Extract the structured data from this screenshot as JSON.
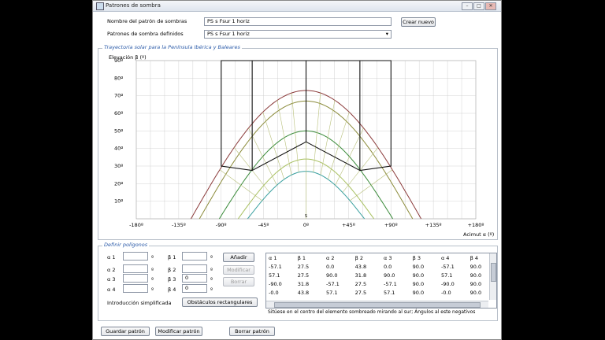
{
  "window": {
    "title": "Patrones de sombra"
  },
  "form": {
    "pattern_name_label": "Nombre del patrón de sombras",
    "pattern_name_value": "PS s Fsur 1 horiz",
    "create_button": "Crear nuevo",
    "defined_label": "Patrones de sombra definidos",
    "defined_value": "PS s Fsur 1 horiz"
  },
  "chart_group_title": "Trayectoria solar para la Península Ibérica y Baleares",
  "chart_data": {
    "type": "line",
    "ylabel": "Elevación β (º)",
    "xlabel": "Acimut α (º)",
    "xlim": [
      -180,
      180
    ],
    "ylim": [
      0,
      90
    ],
    "x_ticks": [
      "-180º",
      "-135º",
      "-90º",
      "-45º",
      "0º",
      "+45º",
      "+90º",
      "+135º",
      "+180º"
    ],
    "y_ticks": [
      "10º",
      "20º",
      "30º",
      "40º",
      "50º",
      "60º",
      "70º",
      "80º",
      "90º"
    ],
    "south_marker": "S",
    "sun_paths": [
      {
        "color": "#8b3a3a",
        "max_elevation": 73,
        "half_width": 122
      },
      {
        "color": "#8b8b3a",
        "max_elevation": 67,
        "half_width": 113
      },
      {
        "color": "#3a8b3a",
        "max_elevation": 50,
        "half_width": 92
      },
      {
        "color": "#a8c060",
        "max_elevation": 34,
        "half_width": 72
      },
      {
        "color": "#3aa0a0",
        "max_elevation": 27,
        "half_width": 62
      }
    ],
    "shadow_polygon": [
      {
        "x": -90,
        "y": 30
      },
      {
        "x": -90,
        "y": 90
      },
      {
        "x": 90,
        "y": 90
      },
      {
        "x": 90,
        "y": 30
      },
      {
        "x": 57.1,
        "y": 27.5
      },
      {
        "x": 0,
        "y": 43.8
      },
      {
        "x": -57.1,
        "y": 27.5
      }
    ],
    "polygon_dividers": [
      -57.1,
      0,
      57.1
    ]
  },
  "polygons": {
    "group_title": "Definir polígonos",
    "inputs": [
      {
        "alpha_label": "α 1",
        "alpha_value": "",
        "beta_label": "β 1",
        "beta_value": ""
      },
      {
        "alpha_label": "α 2",
        "alpha_value": "",
        "beta_label": "β 2",
        "beta_value": ""
      },
      {
        "alpha_label": "α 3",
        "alpha_value": "",
        "beta_label": "β 3",
        "beta_value": "0"
      },
      {
        "alpha_label": "α 4",
        "alpha_value": "",
        "beta_label": "β 4",
        "beta_value": "0"
      }
    ],
    "degree_symbol": "º",
    "add_button": "Añadir",
    "modify_button": "Modificar",
    "delete_button": "Borrar",
    "simplified_label": "Introducción simplificada",
    "rect_obstacles_button": "Obstáculos rectangulares",
    "table": {
      "headers": [
        "α 1",
        "β 1",
        "α 2",
        "β 2",
        "α 3",
        "β 3",
        "α 4",
        "β 4"
      ],
      "rows": [
        [
          "-57.1",
          "27.5",
          "0.0",
          "43.8",
          "0.0",
          "90.0",
          "-57.1",
          "90.0"
        ],
        [
          "57.1",
          "27.5",
          "90.0",
          "31.8",
          "90.0",
          "90.0",
          "57.1",
          "90.0"
        ],
        [
          "-90.0",
          "31.8",
          "-57.1",
          "27.5",
          "-57.1",
          "90.0",
          "-90.0",
          "90.0"
        ],
        [
          "-0.0",
          "43.8",
          "57.1",
          "27.5",
          "57.1",
          "90.0",
          "-0.0",
          "90.0"
        ]
      ]
    },
    "hint": "Sitúese en el centro del elemento sombreado mirando al sur; Ángulos al este negativos"
  },
  "footer": {
    "save": "Guardar patrón",
    "modify": "Modificar patrón",
    "delete": "Borrar patrón"
  },
  "colors": {
    "polygon": "#111111",
    "grid": "#c8c8c8",
    "group_title": "#2a5aa8"
  }
}
